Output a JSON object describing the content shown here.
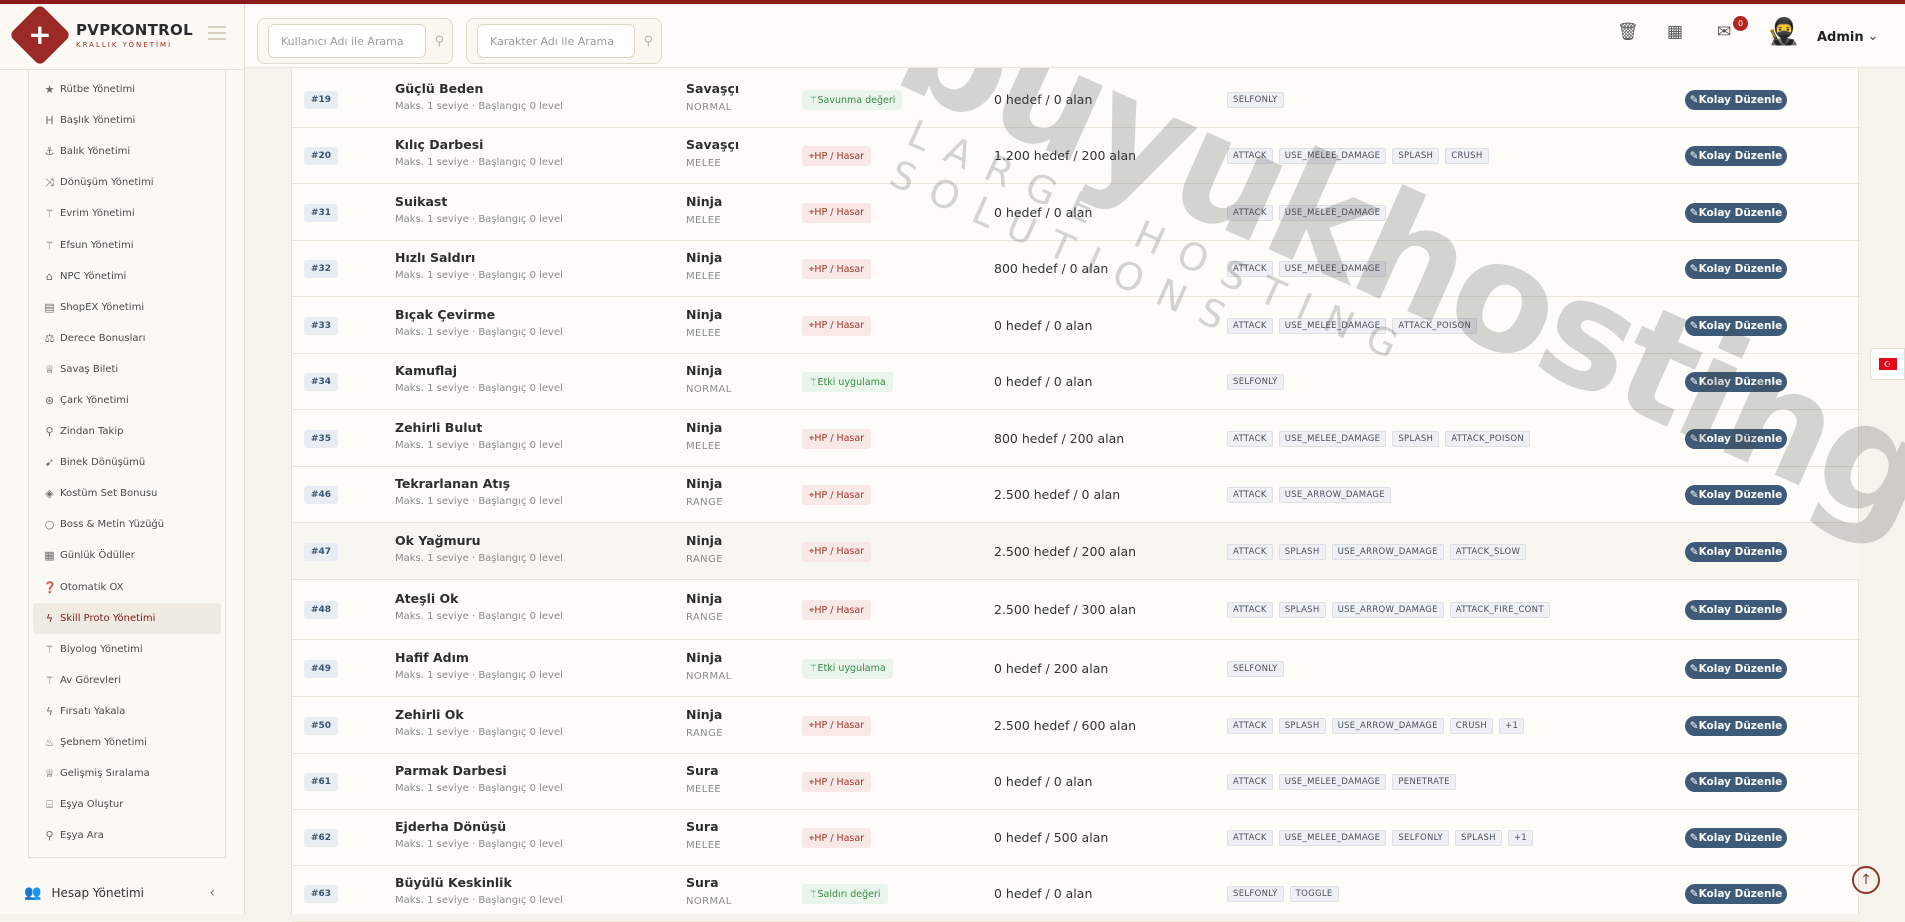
{
  "brand": {
    "title": "PVPKONTROL",
    "subtitle": "KRALLIK YÖNETİMİ"
  },
  "search": {
    "user_placeholder": "Kullanıcı Adı ile Arama",
    "char_placeholder": "Karakter Adı ile Arama"
  },
  "header": {
    "notif_count": "0",
    "user": "Admin"
  },
  "menu": [
    {
      "icon": "star-icon",
      "glyph": "★",
      "label": "Rütbe Yönetimi"
    },
    {
      "icon": "heading-icon",
      "glyph": "H",
      "label": "Başlık Yönetimi"
    },
    {
      "icon": "anchor-icon",
      "glyph": "⚓",
      "label": "Balık Yönetimi"
    },
    {
      "icon": "shuffle-icon",
      "glyph": "⤨",
      "label": "Dönüşüm Yönetimi"
    },
    {
      "icon": "wand-icon",
      "glyph": "⚚",
      "label": "Evrim Yönetimi"
    },
    {
      "icon": "magic-icon",
      "glyph": "⚚",
      "label": "Efsun Yönetimi"
    },
    {
      "icon": "bank-icon",
      "glyph": "⌂",
      "label": "NPC Yönetimi"
    },
    {
      "icon": "shop-icon",
      "glyph": "▤",
      "label": "ShopEX Yönetimi"
    },
    {
      "icon": "scale-icon",
      "glyph": "⚖",
      "label": "Derece Bonusları"
    },
    {
      "icon": "trophy-icon",
      "glyph": "♕",
      "label": "Savaş Bileti"
    },
    {
      "icon": "wheel-icon",
      "glyph": "⊛",
      "label": "Çark Yönetimi"
    },
    {
      "icon": "pin-icon",
      "glyph": "⚲",
      "label": "Zindan Takip"
    },
    {
      "icon": "rocket-icon",
      "glyph": "➹",
      "label": "Binek Dönüşümü"
    },
    {
      "icon": "gem-icon",
      "glyph": "◈",
      "label": "Kostüm Set Bonusu"
    },
    {
      "icon": "ring-icon",
      "glyph": "○",
      "label": "Boss & Metin Yüzüğü"
    },
    {
      "icon": "calendar-icon",
      "glyph": "▦",
      "label": "Günlük Ödüller"
    },
    {
      "icon": "question-icon",
      "glyph": "❓",
      "label": "Otomatik OX"
    },
    {
      "icon": "bolt-icon",
      "glyph": "ϟ",
      "label": "Skill Proto Yönetimi",
      "active": true
    },
    {
      "icon": "wand-icon",
      "glyph": "⚚",
      "label": "Biyolog Yönetimi"
    },
    {
      "icon": "wand-icon",
      "glyph": "⚚",
      "label": "Av Görevleri"
    },
    {
      "icon": "bolt-icon",
      "glyph": "ϟ",
      "label": "Fırsatı Yakala"
    },
    {
      "icon": "flame-icon",
      "glyph": "♨",
      "label": "Şebnem Yönetimi"
    },
    {
      "icon": "trophy-icon",
      "glyph": "♕",
      "label": "Gelişmiş Sıralama"
    },
    {
      "icon": "gift-icon",
      "glyph": "⌸",
      "label": "Eşya Oluştur"
    },
    {
      "icon": "search-icon",
      "glyph": "⚲",
      "label": "Eşya Ara"
    }
  ],
  "account": {
    "label": "Hesap Yönetimi"
  },
  "edit_label": "Kolay Düzenle",
  "rows": [
    {
      "id": "#19",
      "name": "Güçlü Beden",
      "sub": "Maks. 1 seviye · Başlangıç 0 level",
      "cls": "Savaşçı",
      "type": "NORMAL",
      "effect": "Savunma değeri",
      "effect_color": "green",
      "target": "0 hedef / 0 alan",
      "tags": [
        "SELFONLY"
      ]
    },
    {
      "id": "#20",
      "name": "Kılıç Darbesi",
      "sub": "Maks. 1 seviye · Başlangıç 0 level",
      "cls": "Savaşçı",
      "type": "MELEE",
      "effect": "HP / Hasar",
      "effect_color": "red",
      "target": "1.200 hedef / 200 alan",
      "tags": [
        "ATTACK",
        "USE_MELEE_DAMAGE",
        "SPLASH",
        "CRUSH"
      ]
    },
    {
      "id": "#31",
      "name": "Suikast",
      "sub": "Maks. 1 seviye · Başlangıç 0 level",
      "cls": "Ninja",
      "type": "MELEE",
      "effect": "HP / Hasar",
      "effect_color": "red",
      "target": "0 hedef / 0 alan",
      "tags": [
        "ATTACK",
        "USE_MELEE_DAMAGE"
      ]
    },
    {
      "id": "#32",
      "name": "Hızlı Saldırı",
      "sub": "Maks. 1 seviye · Başlangıç 0 level",
      "cls": "Ninja",
      "type": "MELEE",
      "effect": "HP / Hasar",
      "effect_color": "red",
      "target": "800 hedef / 0 alan",
      "tags": [
        "ATTACK",
        "USE_MELEE_DAMAGE"
      ]
    },
    {
      "id": "#33",
      "name": "Bıçak Çevirme",
      "sub": "Maks. 1 seviye · Başlangıç 0 level",
      "cls": "Ninja",
      "type": "MELEE",
      "effect": "HP / Hasar",
      "effect_color": "red",
      "target": "0 hedef / 0 alan",
      "tags": [
        "ATTACK",
        "USE_MELEE_DAMAGE",
        "ATTACK_POISON"
      ]
    },
    {
      "id": "#34",
      "name": "Kamuflaj",
      "sub": "Maks. 1 seviye · Başlangıç 0 level",
      "cls": "Ninja",
      "type": "NORMAL",
      "effect": "Etki uygulama",
      "effect_color": "green",
      "target": "0 hedef / 0 alan",
      "tags": [
        "SELFONLY"
      ]
    },
    {
      "id": "#35",
      "name": "Zehirli Bulut",
      "sub": "Maks. 1 seviye · Başlangıç 0 level",
      "cls": "Ninja",
      "type": "MELEE",
      "effect": "HP / Hasar",
      "effect_color": "red",
      "target": "800 hedef / 200 alan",
      "tags": [
        "ATTACK",
        "USE_MELEE_DAMAGE",
        "SPLASH",
        "ATTACK_POISON"
      ]
    },
    {
      "id": "#46",
      "name": "Tekrarlanan Atış",
      "sub": "Maks. 1 seviye · Başlangıç 0 level",
      "cls": "Ninja",
      "type": "RANGE",
      "effect": "HP / Hasar",
      "effect_color": "red",
      "target": "2.500 hedef / 0 alan",
      "tags": [
        "ATTACK",
        "USE_ARROW_DAMAGE"
      ]
    },
    {
      "id": "#47",
      "name": "Ok Yağmuru",
      "sub": "Maks. 1 seviye · Başlangıç 0 level",
      "cls": "Ninja",
      "type": "RANGE",
      "effect": "HP / Hasar",
      "effect_color": "red",
      "target": "2.500 hedef / 200 alan",
      "tags": [
        "ATTACK",
        "SPLASH",
        "USE_ARROW_DAMAGE",
        "ATTACK_SLOW"
      ],
      "highlight": true
    },
    {
      "id": "#48",
      "name": "Ateşli Ok",
      "sub": "Maks. 1 seviye · Başlangıç 0 level",
      "cls": "Ninja",
      "type": "RANGE",
      "effect": "HP / Hasar",
      "effect_color": "red",
      "target": "2.500 hedef / 300 alan",
      "tags": [
        "ATTACK",
        "SPLASH",
        "USE_ARROW_DAMAGE",
        "ATTACK_FIRE_CONT"
      ]
    },
    {
      "id": "#49",
      "name": "Hafif Adım",
      "sub": "Maks. 1 seviye · Başlangıç 0 level",
      "cls": "Ninja",
      "type": "NORMAL",
      "effect": "Etki uygulama",
      "effect_color": "green",
      "target": "0 hedef / 200 alan",
      "tags": [
        "SELFONLY"
      ]
    },
    {
      "id": "#50",
      "name": "Zehirli Ok",
      "sub": "Maks. 1 seviye · Başlangıç 0 level",
      "cls": "Ninja",
      "type": "RANGE",
      "effect": "HP / Hasar",
      "effect_color": "red",
      "target": "2.500 hedef / 600 alan",
      "tags": [
        "ATTACK",
        "SPLASH",
        "USE_ARROW_DAMAGE",
        "CRUSH",
        "+1"
      ]
    },
    {
      "id": "#61",
      "name": "Parmak Darbesi",
      "sub": "Maks. 1 seviye · Başlangıç 0 level",
      "cls": "Sura",
      "type": "MELEE",
      "effect": "HP / Hasar",
      "effect_color": "red",
      "target": "0 hedef / 0 alan",
      "tags": [
        "ATTACK",
        "USE_MELEE_DAMAGE",
        "PENETRATE"
      ]
    },
    {
      "id": "#62",
      "name": "Ejderha Dönüşü",
      "sub": "Maks. 1 seviye · Başlangıç 0 level",
      "cls": "Sura",
      "type": "MELEE",
      "effect": "HP / Hasar",
      "effect_color": "red",
      "target": "0 hedef / 500 alan",
      "tags": [
        "ATTACK",
        "USE_MELEE_DAMAGE",
        "SELFONLY",
        "SPLASH",
        "+1"
      ]
    },
    {
      "id": "#63",
      "name": "Büyülü Keskinlik",
      "sub": "Maks. 1 seviye · Başlangıç 0 level",
      "cls": "Sura",
      "type": "NORMAL",
      "effect": "Saldırı değeri",
      "effect_color": "green",
      "target": "0 hedef / 0 alan",
      "tags": [
        "SELFONLY",
        "TOGGLE"
      ]
    }
  ],
  "watermark": {
    "main": "buyukhosting",
    "sub": "LARGE HOSTING SOLUTIONS"
  },
  "colors": {
    "brand": "#9b2a26",
    "edit_button": "#3e5a78",
    "active_menu": "#7b1b1b"
  }
}
